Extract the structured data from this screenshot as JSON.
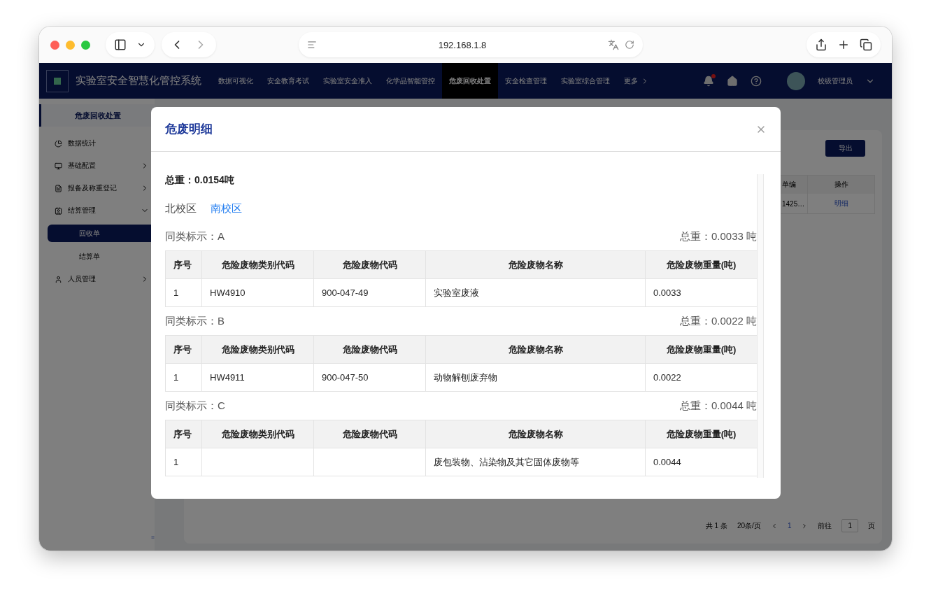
{
  "browser": {
    "url": "192.168.1.8"
  },
  "app": {
    "title": "实验室安全智慧化管控系统",
    "nav": [
      {
        "label": "数据可视化",
        "selected": false
      },
      {
        "label": "安全教育考试",
        "selected": false
      },
      {
        "label": "实验室安全准入",
        "selected": false
      },
      {
        "label": "化学品智能管控",
        "selected": false
      },
      {
        "label": "危废回收处置",
        "selected": true
      },
      {
        "label": "安全检查管理",
        "selected": false
      },
      {
        "label": "实验室综合管理",
        "selected": false
      },
      {
        "label": "更多",
        "selected": false
      }
    ],
    "notification": true,
    "user": "校级管理员"
  },
  "sidebar": {
    "title": "危废回收处置",
    "items": [
      {
        "label": "数据统计",
        "selected": false
      },
      {
        "label": "基础配置",
        "expanded": false,
        "selected": false
      },
      {
        "label": "报备及称重登记",
        "expanded": false,
        "selected": false
      },
      {
        "label": "结算管理",
        "expanded": true,
        "selected": false,
        "children": [
          {
            "label": "回收单",
            "selected": true
          },
          {
            "label": "结算单",
            "selected": false
          }
        ]
      },
      {
        "label": "人员管理",
        "expanded": false,
        "selected": false
      }
    ]
  },
  "page": {
    "export_button": "导出",
    "table": {
      "columns": [
        "单编",
        "操作"
      ],
      "rows": [
        [
          "1425…",
          "明细"
        ]
      ]
    },
    "pagination": {
      "total": "共 1 条",
      "page_size": "20条/页",
      "pages": [
        {
          "label": "1",
          "selected": true
        }
      ],
      "goto_label": "前往",
      "goto_value": "1",
      "goto_suffix": "页"
    }
  },
  "modal": {
    "title": "危废明细",
    "total": "总重：0.0154吨",
    "campuses": [
      {
        "label": "北校区",
        "selected": false
      },
      {
        "label": "南校区",
        "selected": true
      }
    ],
    "groups": [
      {
        "label": "同类标示：A",
        "total": "总重：0.0033 吨",
        "columns": [
          "序号",
          "危险废物类别代码",
          "危险废物代码",
          "危险废物名称",
          "危险废物重量(吨)"
        ],
        "rows": [
          [
            "1",
            "HW4910",
            "900-047-49",
            "实验室废液",
            "0.0033"
          ]
        ]
      },
      {
        "label": "同类标示：B",
        "total": "总重：0.0022 吨",
        "columns": [
          "序号",
          "危险废物类别代码",
          "危险废物代码",
          "危险废物名称",
          "危险废物重量(吨)"
        ],
        "rows": [
          [
            "1",
            "HW4911",
            "900-047-50",
            "动物解刨废弃物",
            "0.0022"
          ]
        ]
      },
      {
        "label": "同类标示：C",
        "total": "总重：0.0044 吨",
        "columns": [
          "序号",
          "危险废物类别代码",
          "危险废物代码",
          "危险废物名称",
          "危险废物重量(吨)"
        ],
        "rows": [
          [
            "1",
            "",
            "",
            "废包装物、沾染物及其它固体废物等",
            "0.0044"
          ]
        ]
      }
    ]
  }
}
